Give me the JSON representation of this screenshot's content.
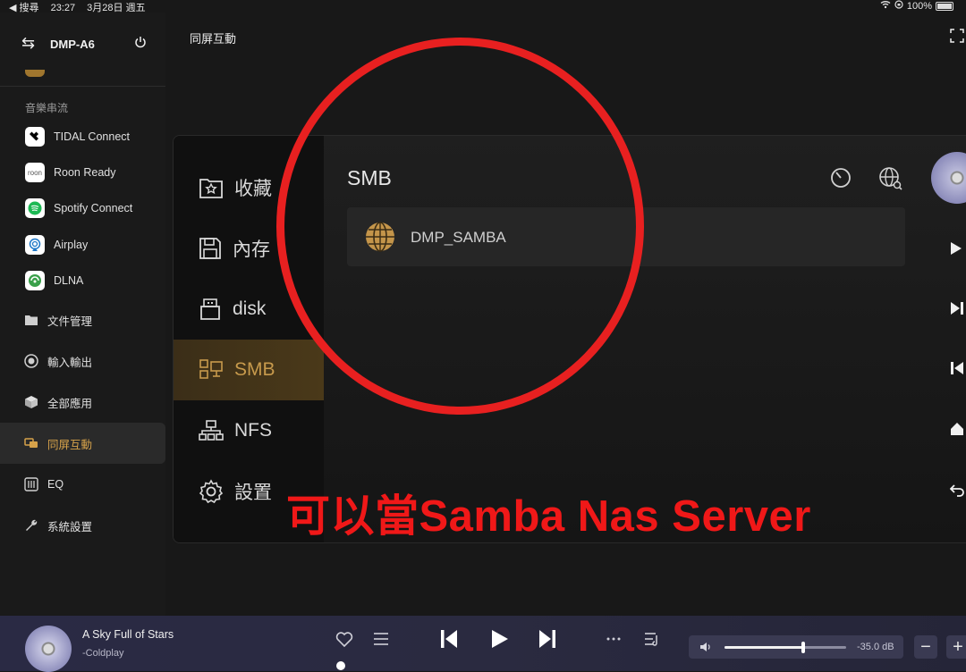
{
  "status": {
    "back": "◀ 搜尋",
    "time": "23:27",
    "date": "3月28日 週五",
    "battery": "100%"
  },
  "sidebar": {
    "device_name": "DMP-A6",
    "section_label": "音樂串流",
    "streaming": [
      {
        "label": "TIDAL Connect",
        "icon": "tidal-icon"
      },
      {
        "label": "Roon Ready",
        "icon": "roon-icon"
      },
      {
        "label": "Spotify Connect",
        "icon": "spotify-icon"
      },
      {
        "label": "Airplay",
        "icon": "airplay-icon"
      },
      {
        "label": "DLNA",
        "icon": "dlna-icon"
      }
    ],
    "menu": [
      {
        "label": "文件管理",
        "icon": "folder-icon"
      },
      {
        "label": "輸入輸出",
        "icon": "io-icon"
      },
      {
        "label": "全部應用",
        "icon": "apps-icon"
      },
      {
        "label": "同屏互動",
        "icon": "screen-mirror-icon",
        "active": true
      },
      {
        "label": "EQ",
        "icon": "eq-icon"
      },
      {
        "label": "系統設置",
        "icon": "wrench-icon"
      }
    ]
  },
  "header": {
    "title": "同屏互動"
  },
  "panel": {
    "nav": [
      {
        "label": "收藏",
        "icon": "favorites-icon"
      },
      {
        "label": "內存",
        "icon": "storage-icon"
      },
      {
        "label": "disk",
        "icon": "usb-icon"
      },
      {
        "label": "SMB",
        "icon": "smb-icon",
        "active": true
      },
      {
        "label": "NFS",
        "icon": "nfs-icon"
      },
      {
        "label": "設置",
        "icon": "settings-icon"
      }
    ],
    "section_title": "SMB",
    "servers": [
      {
        "name": "DMP_SAMBA"
      }
    ]
  },
  "annotation": {
    "text": "可以當Samba Nas Server",
    "color": "#f01818"
  },
  "player": {
    "song": "A Sky Full of Stars",
    "artist": "-Coldplay",
    "volume_db": "-35.0 dB",
    "volume_level": 0.65,
    "minus": "−",
    "plus": "+"
  },
  "colors": {
    "accent": "#c79a4c",
    "background": "#181818",
    "annotation_red": "#e82020"
  }
}
